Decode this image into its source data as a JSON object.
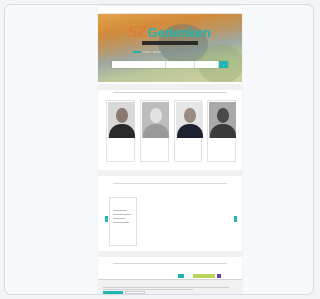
{
  "site": {
    "logo_prefix": "SZ",
    "logo_word": "Gedenken"
  },
  "nav": {
    "items": [
      "",
      "",
      "",
      "",
      "",
      ""
    ]
  },
  "hero": {
    "tagline": "",
    "tabs": [
      "",
      "",
      ""
    ],
    "search": {
      "name_placeholder": "",
      "place_placeholder": "",
      "date_placeholder": "",
      "go_label": "›"
    },
    "advanced_link": ""
  },
  "featured": {
    "title": "",
    "subtitle": "",
    "people": [
      {
        "name": "",
        "role": ""
      },
      {
        "name": "",
        "role": ""
      },
      {
        "name": "",
        "role": ""
      },
      {
        "name": "",
        "role": ""
      }
    ],
    "more_link": ""
  },
  "obituaries": {
    "title": "",
    "subtitle": "",
    "book_title": "",
    "more_link": "",
    "arrow_left": "‹",
    "arrow_right": "›"
  },
  "announcements": {
    "title": "",
    "subtitle": "",
    "tabs": [
      "",
      "",
      "",
      ""
    ]
  },
  "cookie": {
    "title": "",
    "text": "",
    "accept_label": "",
    "settings_label": ""
  },
  "colors": {
    "accent": "#1fb6b0",
    "logo_orange": "#e07b33"
  }
}
